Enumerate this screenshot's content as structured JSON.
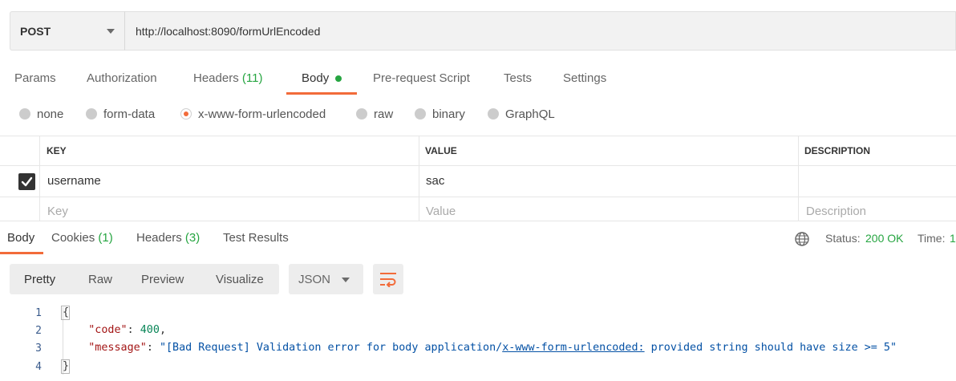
{
  "request": {
    "method": "POST",
    "url": "http://localhost:8090/formUrlEncoded"
  },
  "request_tabs": [
    {
      "label": "Params"
    },
    {
      "label": "Authorization"
    },
    {
      "label": "Headers",
      "count": "(11)"
    },
    {
      "label": "Body",
      "active": true
    },
    {
      "label": "Pre-request Script"
    },
    {
      "label": "Tests"
    },
    {
      "label": "Settings"
    }
  ],
  "body_types": [
    "none",
    "form-data",
    "x-www-form-urlencoded",
    "raw",
    "binary",
    "GraphQL"
  ],
  "body_type_selected": "x-www-form-urlencoded",
  "kv_table": {
    "headers": [
      "KEY",
      "VALUE",
      "DESCRIPTION"
    ],
    "rows": [
      {
        "checked": true,
        "key": "username",
        "value": "sac",
        "description": ""
      }
    ],
    "placeholders": {
      "key": "Key",
      "value": "Value",
      "description": "Description"
    }
  },
  "response_tabs": [
    {
      "label": "Body",
      "active": true
    },
    {
      "label": "Cookies",
      "count": "(1)"
    },
    {
      "label": "Headers",
      "count": "(3)"
    },
    {
      "label": "Test Results"
    }
  ],
  "response_status": {
    "status_label": "Status:",
    "status_value": "200 OK",
    "time_label": "Time:",
    "time_value": "1"
  },
  "viewer": {
    "modes": [
      "Pretty",
      "Raw",
      "Preview",
      "Visualize"
    ],
    "active_mode": "Pretty",
    "format": "JSON"
  },
  "response_body": {
    "line_numbers": [
      "1",
      "2",
      "3",
      "4"
    ],
    "open_brace": "{",
    "close_brace": "}",
    "code_key": "\"code\"",
    "code_value": "400",
    "message_key": "\"message\"",
    "message_prefix": "\"[Bad Request] Validation error for body application/",
    "message_link": "x-www-form-urlencoded:",
    "message_suffix": " provided string should have size >= 5\""
  },
  "colors": {
    "accent": "#f26b3a",
    "success": "#26a541"
  }
}
